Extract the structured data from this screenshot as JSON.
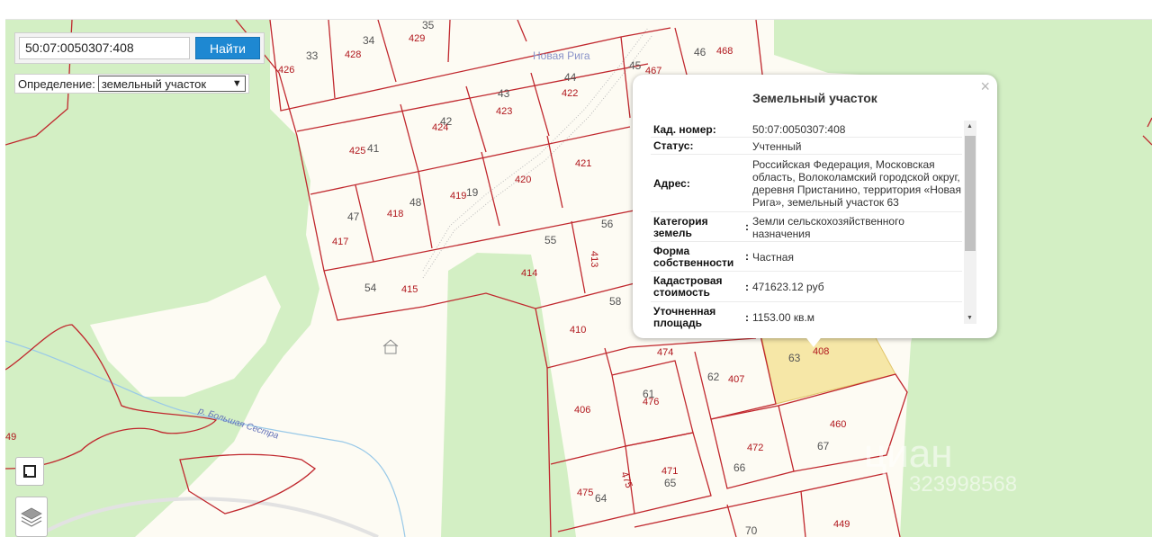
{
  "search": {
    "value": "50:07:0050307:408",
    "button_label": "Найти"
  },
  "definition": {
    "label": "Определение:",
    "selected": "земельный участок"
  },
  "popup": {
    "title": "Земельный участок",
    "close": "×",
    "rows": [
      {
        "key": "Кад. номер",
        "value": "50:07:0050307:408"
      },
      {
        "key": "Статус",
        "value": "Учтенный"
      },
      {
        "key": "Адрес",
        "value": "Российская Федерация, Московская область, Волоколамский городской округ, деревня Пристанино, территория «Новая Рига», земельный участок 63"
      },
      {
        "key": "Категория земель",
        "value": "Земли сельскохозяйственного назначения"
      },
      {
        "key": "Форма собственности",
        "value": "Частная"
      },
      {
        "key": "Кадастровая стоимость",
        "value": "471623.12 руб"
      },
      {
        "key": "Уточненная площадь",
        "value": "1153.00 кв.м"
      }
    ]
  },
  "map": {
    "place_name": "Новая Рига",
    "river_name": "р. Большая Сестра",
    "watermark": "циан",
    "watermark_phone": "323998568",
    "parcel_numbers": [
      "426",
      "33",
      "428",
      "34",
      "429",
      "35",
      "46",
      "468",
      "45",
      "467",
      "44",
      "422",
      "43",
      "423",
      "424",
      "42",
      "425",
      "41",
      "421",
      "420",
      "419",
      "418",
      "48",
      "47",
      "417",
      "415",
      "54",
      "55",
      "414",
      "413",
      "56",
      "58",
      "410",
      "474",
      "62",
      "407",
      "63",
      "408",
      "61",
      "476",
      "406",
      "460",
      "472",
      "67",
      "66",
      "471",
      "65",
      "475",
      "475",
      "64",
      "449",
      "70",
      "49"
    ],
    "colors": {
      "parcel_border": "#c0272d",
      "parcel_label": "#b0161c",
      "forest": "#d3efc4",
      "background": "#fdfbf3",
      "selected_parcel": "#f6e7a7",
      "river": "#99c9e8",
      "search_button": "#1e88d2"
    }
  },
  "icons": {
    "frame": "frame-icon",
    "layers": "layers-icon",
    "scroll_up": "▲",
    "scroll_down": "▼"
  }
}
